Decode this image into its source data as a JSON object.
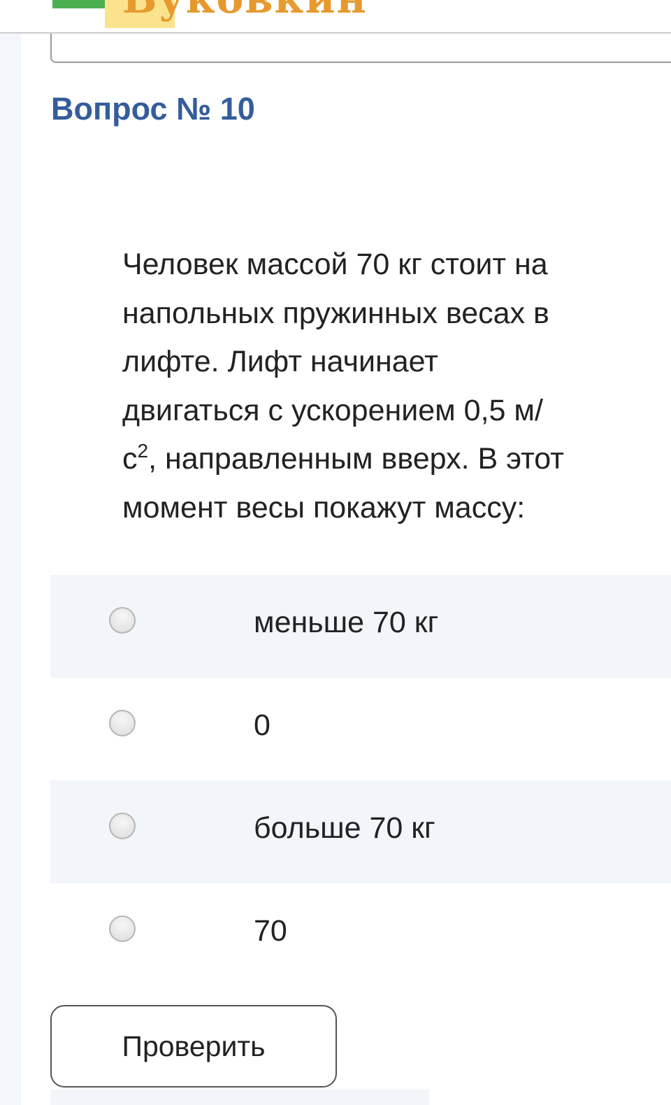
{
  "site": {
    "logo_text": "Буковкин"
  },
  "question": {
    "title": "Вопрос № 10",
    "lines": [
      "Человек массой 70 кг стоит на",
      "напольных пружинных весах в",
      "лифте. Лифт начинает",
      "двигаться с ускорением 0,5 м/"
    ],
    "line5_pre": "с",
    "line5_sup": "2",
    "line5_post": ", направленным вверх. В этот",
    "line6": "момент весы покажут массу:"
  },
  "answers": [
    {
      "label": "меньше 70 кг"
    },
    {
      "label": "0"
    },
    {
      "label": "больше 70 кг"
    },
    {
      "label": "70"
    }
  ],
  "buttons": {
    "check_label": "Проверить"
  },
  "colors": {
    "title": "#355c9c",
    "row_shade": "#f2f5f9",
    "logo_accent": "#e69a2e"
  }
}
